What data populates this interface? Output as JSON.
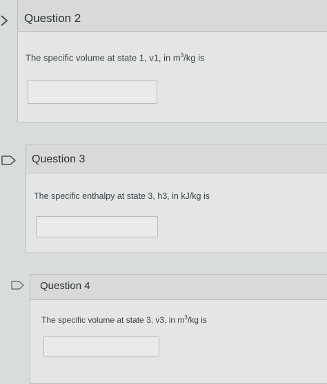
{
  "questions": [
    {
      "title": "Question 2",
      "text_prefix": "The specific volume at state 1, v1, in m",
      "text_sup": "3",
      "text_suffix": "/kg is",
      "answer_value": ""
    },
    {
      "title": "Question 3",
      "text_prefix": "The specific enthalpy at state 3, h3, in kJ/kg is",
      "answer_value": ""
    },
    {
      "title": "Question 4",
      "text_prefix": "The specific volume at state 3, v3, in m",
      "text_sup": "3",
      "text_suffix": "/kg is",
      "answer_value": ""
    }
  ],
  "icons": {
    "flag": "flag-question-icon",
    "chevron": "chevron-right-icon"
  },
  "colors": {
    "panel": "#e4e6e6",
    "header": "#d8dada",
    "border": "#b9bdbd",
    "text": "#2d3b45"
  }
}
